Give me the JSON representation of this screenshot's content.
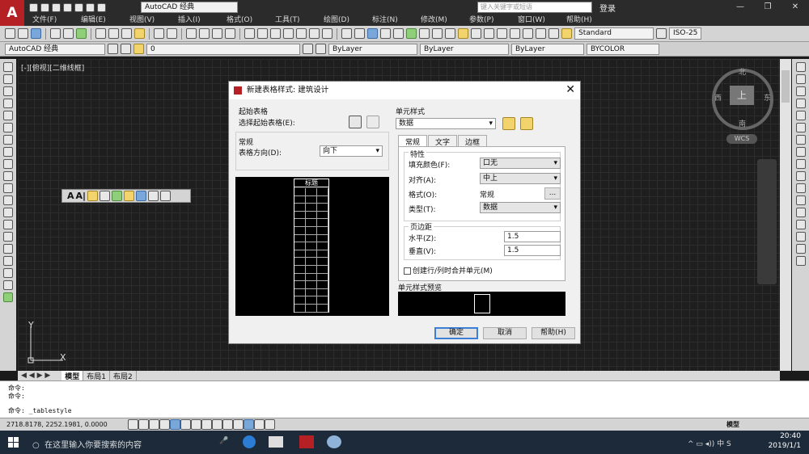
{
  "app": {
    "workspace_combo": "AutoCAD 经典",
    "search_placeholder": "键入关键字或短语",
    "login": "登录"
  },
  "menu": [
    "文件(F)",
    "编辑(E)",
    "视图(V)",
    "插入(I)",
    "格式(O)",
    "工具(T)",
    "绘图(D)",
    "标注(N)",
    "修改(M)",
    "参数(P)",
    "窗口(W)",
    "帮助(H)"
  ],
  "toolbar2": {
    "workspace": "AutoCAD 经典",
    "layer_value": "0",
    "color": "ByLayer",
    "linetype": "ByLayer",
    "lineweight": "ByLayer",
    "plotstyle": "BYCOLOR",
    "text_style": "Standard",
    "dim_style": "ISO-25"
  },
  "viewport": {
    "label": "[-][俯视][二维线框]",
    "compass_n": "北",
    "compass_s": "南",
    "compass_e": "东",
    "compass_w": "西",
    "cube_top": "上",
    "wcs": "WCS",
    "ucs_x": "X",
    "ucs_y": "Y"
  },
  "layout_tabs": [
    "模型",
    "布局1",
    "布局2"
  ],
  "command": {
    "lines": [
      "命令:",
      "命令:"
    ],
    "prompt": "命令:  _tablestyle"
  },
  "status": {
    "coords": "2718.8178, 2252.1981, 0.0000",
    "model": "模型"
  },
  "taskbar": {
    "search": "在这里输入你要搜索的内容",
    "time": "20:40",
    "date": "2019/1/1"
  },
  "dialog": {
    "title": "新建表格样式: 建筑设计",
    "start_table": {
      "title": "起始表格",
      "label": "选择起始表格(E):"
    },
    "general": {
      "title": "常规",
      "direction_label": "表格方向(D):",
      "direction_value": "向下"
    },
    "preview_title": "标题",
    "cell_style": {
      "title": "单元样式",
      "value": "数据"
    },
    "tabs": [
      "常规",
      "文字",
      "边框"
    ],
    "properties": {
      "title": "特性",
      "fill_label": "填充颜色(F):",
      "fill_value": "口无",
      "align_label": "对齐(A):",
      "align_value": "中上",
      "format_label": "格式(O):",
      "format_value": "常规",
      "format_button": "...",
      "type_label": "类型(T):",
      "type_value": "数据"
    },
    "margins": {
      "title": "页边距",
      "horizontal_label": "水平(Z):",
      "horizontal_value": "1.5",
      "vertical_label": "垂直(V):",
      "vertical_value": "1.5"
    },
    "merge_label": "创建行/列时合并单元(M)",
    "cell_preview_title": "单元样式预览",
    "buttons": {
      "ok": "确定",
      "cancel": "取消",
      "help": "帮助(H)"
    }
  }
}
